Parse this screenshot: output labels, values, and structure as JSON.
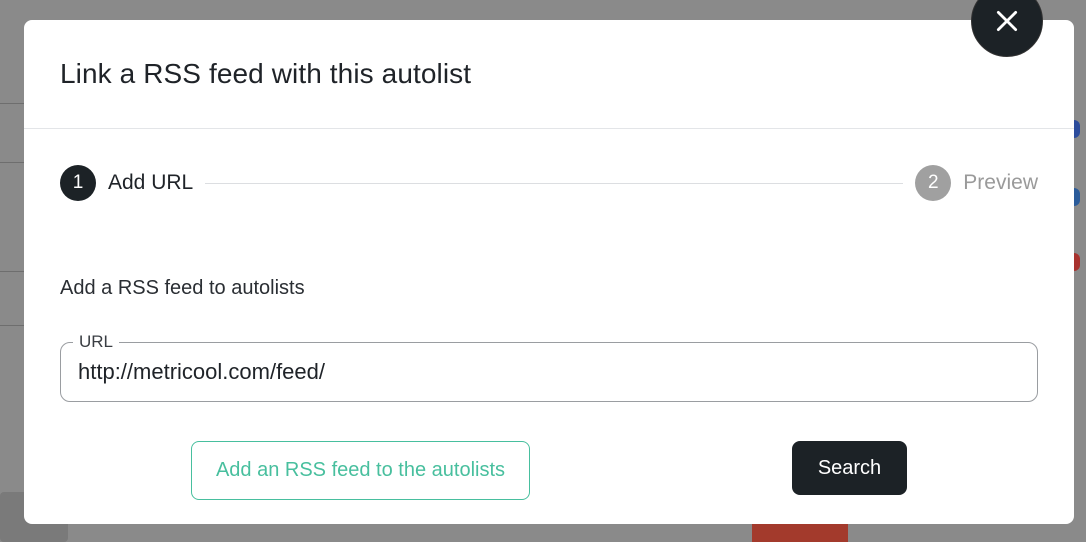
{
  "modal": {
    "title": "Link a RSS feed with this autolist"
  },
  "icons": {
    "close": "close-icon"
  },
  "stepper": {
    "steps": [
      {
        "number": "1",
        "label": "Add URL",
        "state": "active"
      },
      {
        "number": "2",
        "label": "Preview",
        "state": "inactive"
      }
    ]
  },
  "form": {
    "section_text": "Add a RSS feed to autolists",
    "url_label": "URL",
    "url_value": "http://metricool.com/feed/"
  },
  "actions": {
    "add_rss_label": "Add an RSS feed to the autolists",
    "search_label": "Search"
  },
  "colors": {
    "overlay": "#808080",
    "primary_dark": "#1c2226",
    "accent_green": "#48bf9e",
    "inactive_step": "#a0a0a0"
  }
}
